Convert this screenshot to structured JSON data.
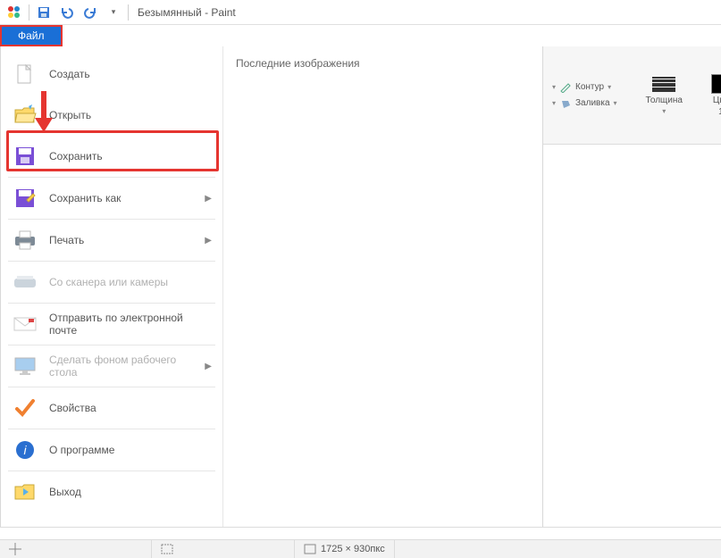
{
  "title": "Безымянный - Paint",
  "filetab": "Файл",
  "menu": {
    "create": "Создать",
    "open": "Открыть",
    "save": "Сохранить",
    "saveas": "Сохранить как",
    "print": "Печать",
    "scanner": "Со сканера или камеры",
    "email": "Отправить по электронной почте",
    "wallpaper": "Сделать фоном рабочего стола",
    "properties": "Свойства",
    "about": "О программе",
    "exit": "Выход"
  },
  "recent_title": "Последние изображения",
  "ribbon": {
    "contour": "Контур",
    "fill": "Заливка",
    "thickness": "Толщина",
    "color1_a": "Цве",
    "color1_b": "1"
  },
  "status": {
    "size": "1725 × 930пкс"
  }
}
